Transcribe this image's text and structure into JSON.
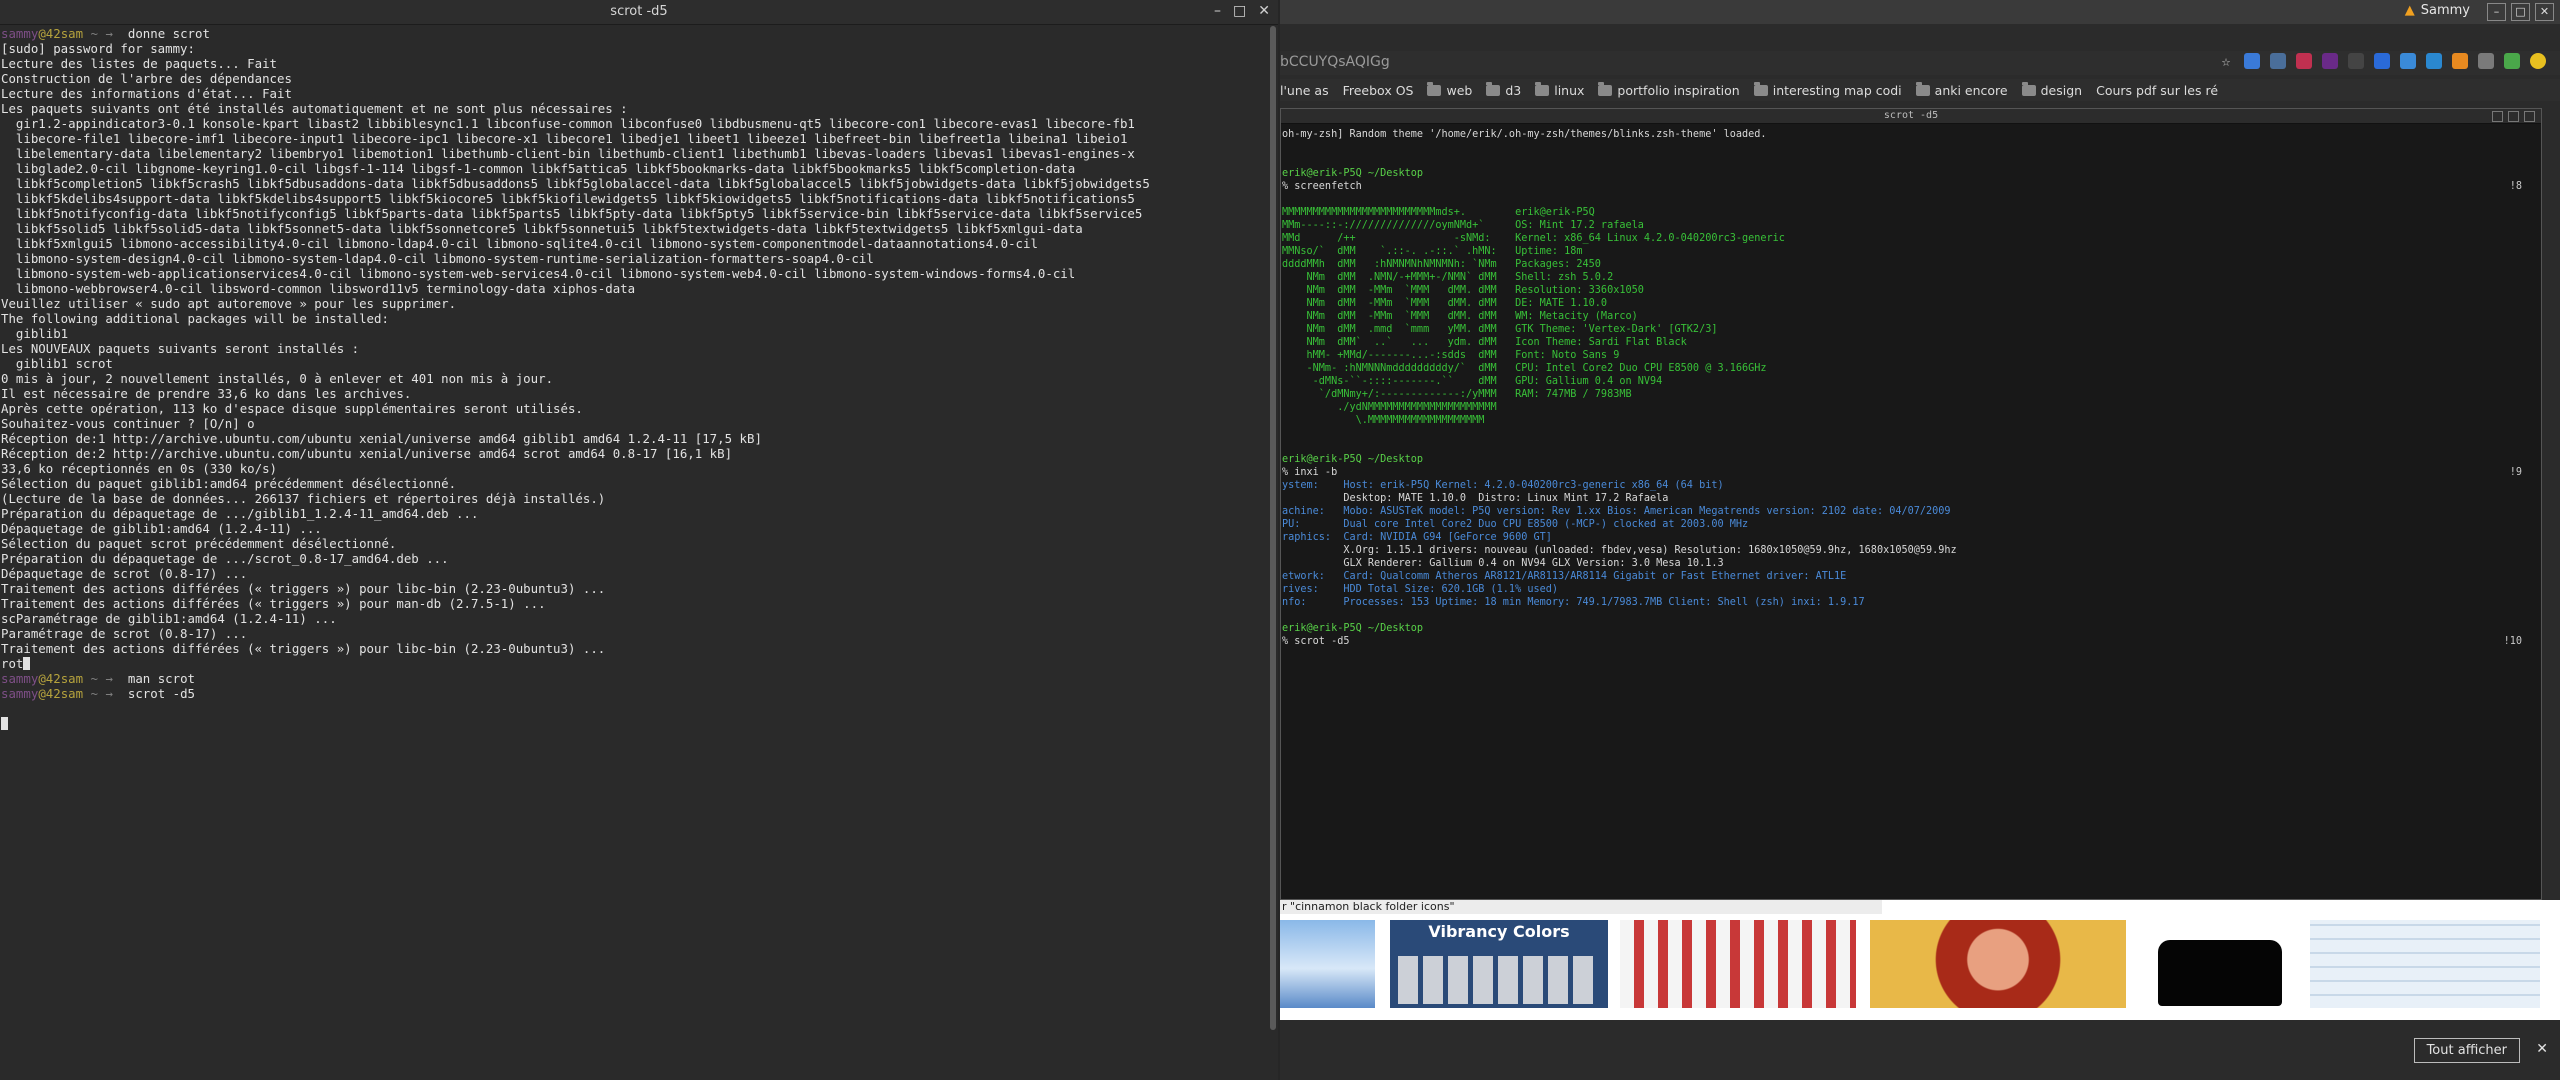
{
  "terminal": {
    "title": "scrot -d5",
    "window_buttons": [
      "–",
      "□",
      "✕"
    ],
    "lines": [
      "donne scrot",
      "[sudo] password for sammy:",
      "Lecture des listes de paquets... Fait",
      "Construction de l'arbre des dépendances",
      "Lecture des informations d'état... Fait",
      "Les paquets suivants ont été installés automatiquement et ne sont plus nécessaires :",
      "  gir1.2-appindicator3-0.1 konsole-kpart libast2 libbiblesync1.1 libconfuse-common libconfuse0 libdbusmenu-qt5 libecore-con1 libecore-evas1 libecore-fb1",
      "  libecore-file1 libecore-imf1 libecore-input1 libecore-ipc1 libecore-x1 libecore1 libedje1 libeet1 libeeze1 libefreet-bin libefreet1a libeina1 libeio1",
      "  libelementary-data libelementary2 libembryo1 libemotion1 libethumb-client-bin libethumb-client1 libethumb1 libevas-loaders libevas1 libevas1-engines-x",
      "  libglade2.0-cil libgnome-keyring1.0-cil libgsf-1-114 libgsf-1-common libkf5attica5 libkf5bookmarks-data libkf5bookmarks5 libkf5completion-data",
      "  libkf5completion5 libkf5crash5 libkf5dbusaddons-data libkf5dbusaddons5 libkf5globalaccel-data libkf5globalaccel5 libkf5jobwidgets-data libkf5jobwidgets5",
      "  libkf5kdelibs4support-data libkf5kdelibs4support5 libkf5kiocore5 libkf5kiofilewidgets5 libkf5kiowidgets5 libkf5notifications-data libkf5notifications5",
      "  libkf5notifyconfig-data libkf5notifyconfig5 libkf5parts-data libkf5parts5 libkf5pty-data libkf5pty5 libkf5service-bin libkf5service-data libkf5service5",
      "  libkf5solid5 libkf5solid5-data libkf5sonnet5-data libkf5sonnetcore5 libkf5sonnetui5 libkf5textwidgets-data libkf5textwidgets5 libkf5xmlgui-data",
      "  libkf5xmlgui5 libmono-accessibility4.0-cil libmono-ldap4.0-cil libmono-sqlite4.0-cil libmono-system-componentmodel-dataannotations4.0-cil",
      "  libmono-system-design4.0-cil libmono-system-ldap4.0-cil libmono-system-runtime-serialization-formatters-soap4.0-cil",
      "  libmono-system-web-applicationservices4.0-cil libmono-system-web-services4.0-cil libmono-system-web4.0-cil libmono-system-windows-forms4.0-cil",
      "  libmono-webbrowser4.0-cil libsword-common libsword11v5 terminology-data xiphos-data",
      "Veuillez utiliser « sudo apt autoremove » pour les supprimer.",
      "The following additional packages will be installed:",
      "  giblib1",
      "Les NOUVEAUX paquets suivants seront installés :",
      "  giblib1 scrot",
      "0 mis à jour, 2 nouvellement installés, 0 à enlever et 401 non mis à jour.",
      "Il est nécessaire de prendre 33,6 ko dans les archives.",
      "Après cette opération, 113 ko d'espace disque supplémentaires seront utilisés.",
      "Souhaitez-vous continuer ? [O/n] o",
      "Réception de:1 http://archive.ubuntu.com/ubuntu xenial/universe amd64 giblib1 amd64 1.2.4-11 [17,5 kB]",
      "Réception de:2 http://archive.ubuntu.com/ubuntu xenial/universe amd64 scrot amd64 0.8-17 [16,1 kB]",
      "33,6 ko réceptionnés en 0s (330 ko/s)",
      "Sélection du paquet giblib1:amd64 précédemment désélectionné.",
      "(Lecture de la base de données... 266137 fichiers et répertoires déjà installés.)",
      "Préparation du dépaquetage de .../giblib1_1.2.4-11_amd64.deb ...",
      "Dépaquetage de giblib1:amd64 (1.2.4-11) ...",
      "Sélection du paquet scrot précédemment désélectionné.",
      "Préparation du dépaquetage de .../scrot_0.8-17_amd64.deb ...",
      "Dépaquetage de scrot (0.8-17) ...",
      "Traitement des actions différées (« triggers ») pour libc-bin (2.23-0ubuntu3) ...",
      "Traitement des actions différées (« triggers ») pour man-db (2.7.5-1) ...",
      "scParamétrage de giblib1:amd64 (1.2.4-11) ...",
      "Paramétrage de scrot (0.8-17) ...",
      "Traitement des actions différées (« triggers ») pour libc-bin (2.23-0ubuntu3) ...",
      "rot"
    ],
    "prompt_user": "sammy",
    "prompt_host": "@42sam",
    "prompt_sep": " ~ ",
    "prompt_arrow": "→",
    "cmd1": "man scrot",
    "cmd2": "scrot -d5"
  },
  "browser": {
    "user_name": "Sammy",
    "url_fragment": "bCCUYQsAQIGg",
    "bookmarks": [
      {
        "label": "l'une as",
        "folder": false
      },
      {
        "label": "Freebox OS",
        "folder": false
      },
      {
        "label": "web",
        "folder": true
      },
      {
        "label": "d3",
        "folder": true
      },
      {
        "label": "linux",
        "folder": true
      },
      {
        "label": "portfolio inspiration",
        "folder": true
      },
      {
        "label": "interesting map codi",
        "folder": true
      },
      {
        "label": "anki encore",
        "folder": true
      },
      {
        "label": "design",
        "folder": true
      },
      {
        "label": "Cours pdf sur les ré",
        "folder": false
      }
    ],
    "image_search_query": "r \"cinnamon black folder icons\"",
    "thumb_text": "Vibrancy Colors",
    "show_all": "Tout afficher",
    "close": "✕",
    "colors": {
      "accent_orange": "#f0a020",
      "prompt_user": "#7e4f87",
      "prompt_host": "#b5a23d"
    }
  },
  "screenshot": {
    "title": "scrot -d5",
    "lines": [
      {
        "text": "oh-my-zsh] Random theme '/home/erik/.oh-my-zsh/themes/blinks.zsh-theme' loaded.",
        "num": ""
      },
      {
        "text": "",
        "num": ""
      },
      {
        "text": "",
        "num": ""
      },
      {
        "text": "erik@erik-P5Q ~/Desktop",
        "num": ""
      },
      {
        "text": "% screenfetch",
        "num": "!8"
      },
      {
        "text": "",
        "num": ""
      },
      {
        "text": "MMMMMMMMMMMMMMMMMMMMMMMMMmds+.        erik@erik-P5Q",
        "num": ""
      },
      {
        "text": "MMm----::-://////////////oymNMd+`     OS: Mint 17.2 rafaela",
        "num": ""
      },
      {
        "text": "MMd      /++                -sNMd:    Kernel: x86_64 Linux 4.2.0-040200rc3-generic",
        "num": ""
      },
      {
        "text": "MMNso/`  dMM    `.::-. .-::.` .hMN:   Uptime: 18m",
        "num": ""
      },
      {
        "text": "ddddMMh  dMM   :hNMNMNhNMNMNh: `NMm   Packages: 2450",
        "num": ""
      },
      {
        "text": "    NMm  dMM  .NMN/-+MMM+-/NMN` dMM   Shell: zsh 5.0.2",
        "num": ""
      },
      {
        "text": "    NMm  dMM  -MMm  `MMM   dMM. dMM   Resolution: 3360x1050",
        "num": ""
      },
      {
        "text": "    NMm  dMM  -MMm  `MMM   dMM. dMM   DE: MATE 1.10.0",
        "num": ""
      },
      {
        "text": "    NMm  dMM  -MMm  `MMM   dMM. dMM   WM: Metacity (Marco)",
        "num": ""
      },
      {
        "text": "    NMm  dMM  .mmd  `mmm   yMM. dMM   GTK Theme: 'Vertex-Dark' [GTK2/3]",
        "num": ""
      },
      {
        "text": "    NMm  dMM`  ..`   ...   ydm. dMM   Icon Theme: Sardi Flat Black",
        "num": ""
      },
      {
        "text": "    hMM- +MMd/-------...-:sdds  dMM   Font: Noto Sans 9",
        "num": ""
      },
      {
        "text": "    -NMm- :hNMNNNmdddddddddy/`  dMM   CPU: Intel Core2 Duo CPU E8500 @ 3.166GHz",
        "num": ""
      },
      {
        "text": "     -dMNs-``-::::-------.``    dMM   GPU: Gallium 0.4 on NV94",
        "num": ""
      },
      {
        "text": "      `/dMNmy+/:-------------:/yMMM   RAM: 747MB / 7983MB",
        "num": ""
      },
      {
        "text": "         ./ydNMMMMMMMMMMMMMMMMMMMMM",
        "num": ""
      },
      {
        "text": "            \\.MMMMMMMMMMMMMMMMMMM",
        "num": ""
      },
      {
        "text": "",
        "num": ""
      },
      {
        "text": "",
        "num": ""
      },
      {
        "text": "erik@erik-P5Q ~/Desktop",
        "num": ""
      },
      {
        "text": "% inxi -b",
        "num": "!9"
      },
      {
        "text": "ystem:    Host: erik-P5Q Kernel: 4.2.0-040200rc3-generic x86_64 (64 bit)",
        "num": ""
      },
      {
        "text": "          Desktop: MATE 1.10.0  Distro: Linux Mint 17.2 Rafaela",
        "num": ""
      },
      {
        "text": "achine:   Mobo: ASUSTeK model: P5Q version: Rev 1.xx Bios: American Megatrends version: 2102 date: 04/07/2009",
        "num": ""
      },
      {
        "text": "PU:       Dual core Intel Core2 Duo CPU E8500 (-MCP-) clocked at 2003.00 MHz",
        "num": ""
      },
      {
        "text": "raphics:  Card: NVIDIA G94 [GeForce 9600 GT]",
        "num": ""
      },
      {
        "text": "          X.Org: 1.15.1 drivers: nouveau (unloaded: fbdev,vesa) Resolution: 1680x1050@59.9hz, 1680x1050@59.9hz",
        "num": ""
      },
      {
        "text": "          GLX Renderer: Gallium 0.4 on NV94 GLX Version: 3.0 Mesa 10.1.3",
        "num": ""
      },
      {
        "text": "etwork:   Card: Qualcomm Atheros AR8121/AR8113/AR8114 Gigabit or Fast Ethernet driver: ATL1E",
        "num": ""
      },
      {
        "text": "rives:    HDD Total Size: 620.1GB (1.1% used)",
        "num": ""
      },
      {
        "text": "nfo:      Processes: 153 Uptime: 18 min Memory: 749.1/7983.7MB Client: Shell (zsh) inxi: 1.9.17",
        "num": ""
      },
      {
        "text": "",
        "num": ""
      },
      {
        "text": "erik@erik-P5Q ~/Desktop",
        "num": ""
      },
      {
        "text": "% scrot -d5",
        "num": "!10"
      }
    ]
  }
}
